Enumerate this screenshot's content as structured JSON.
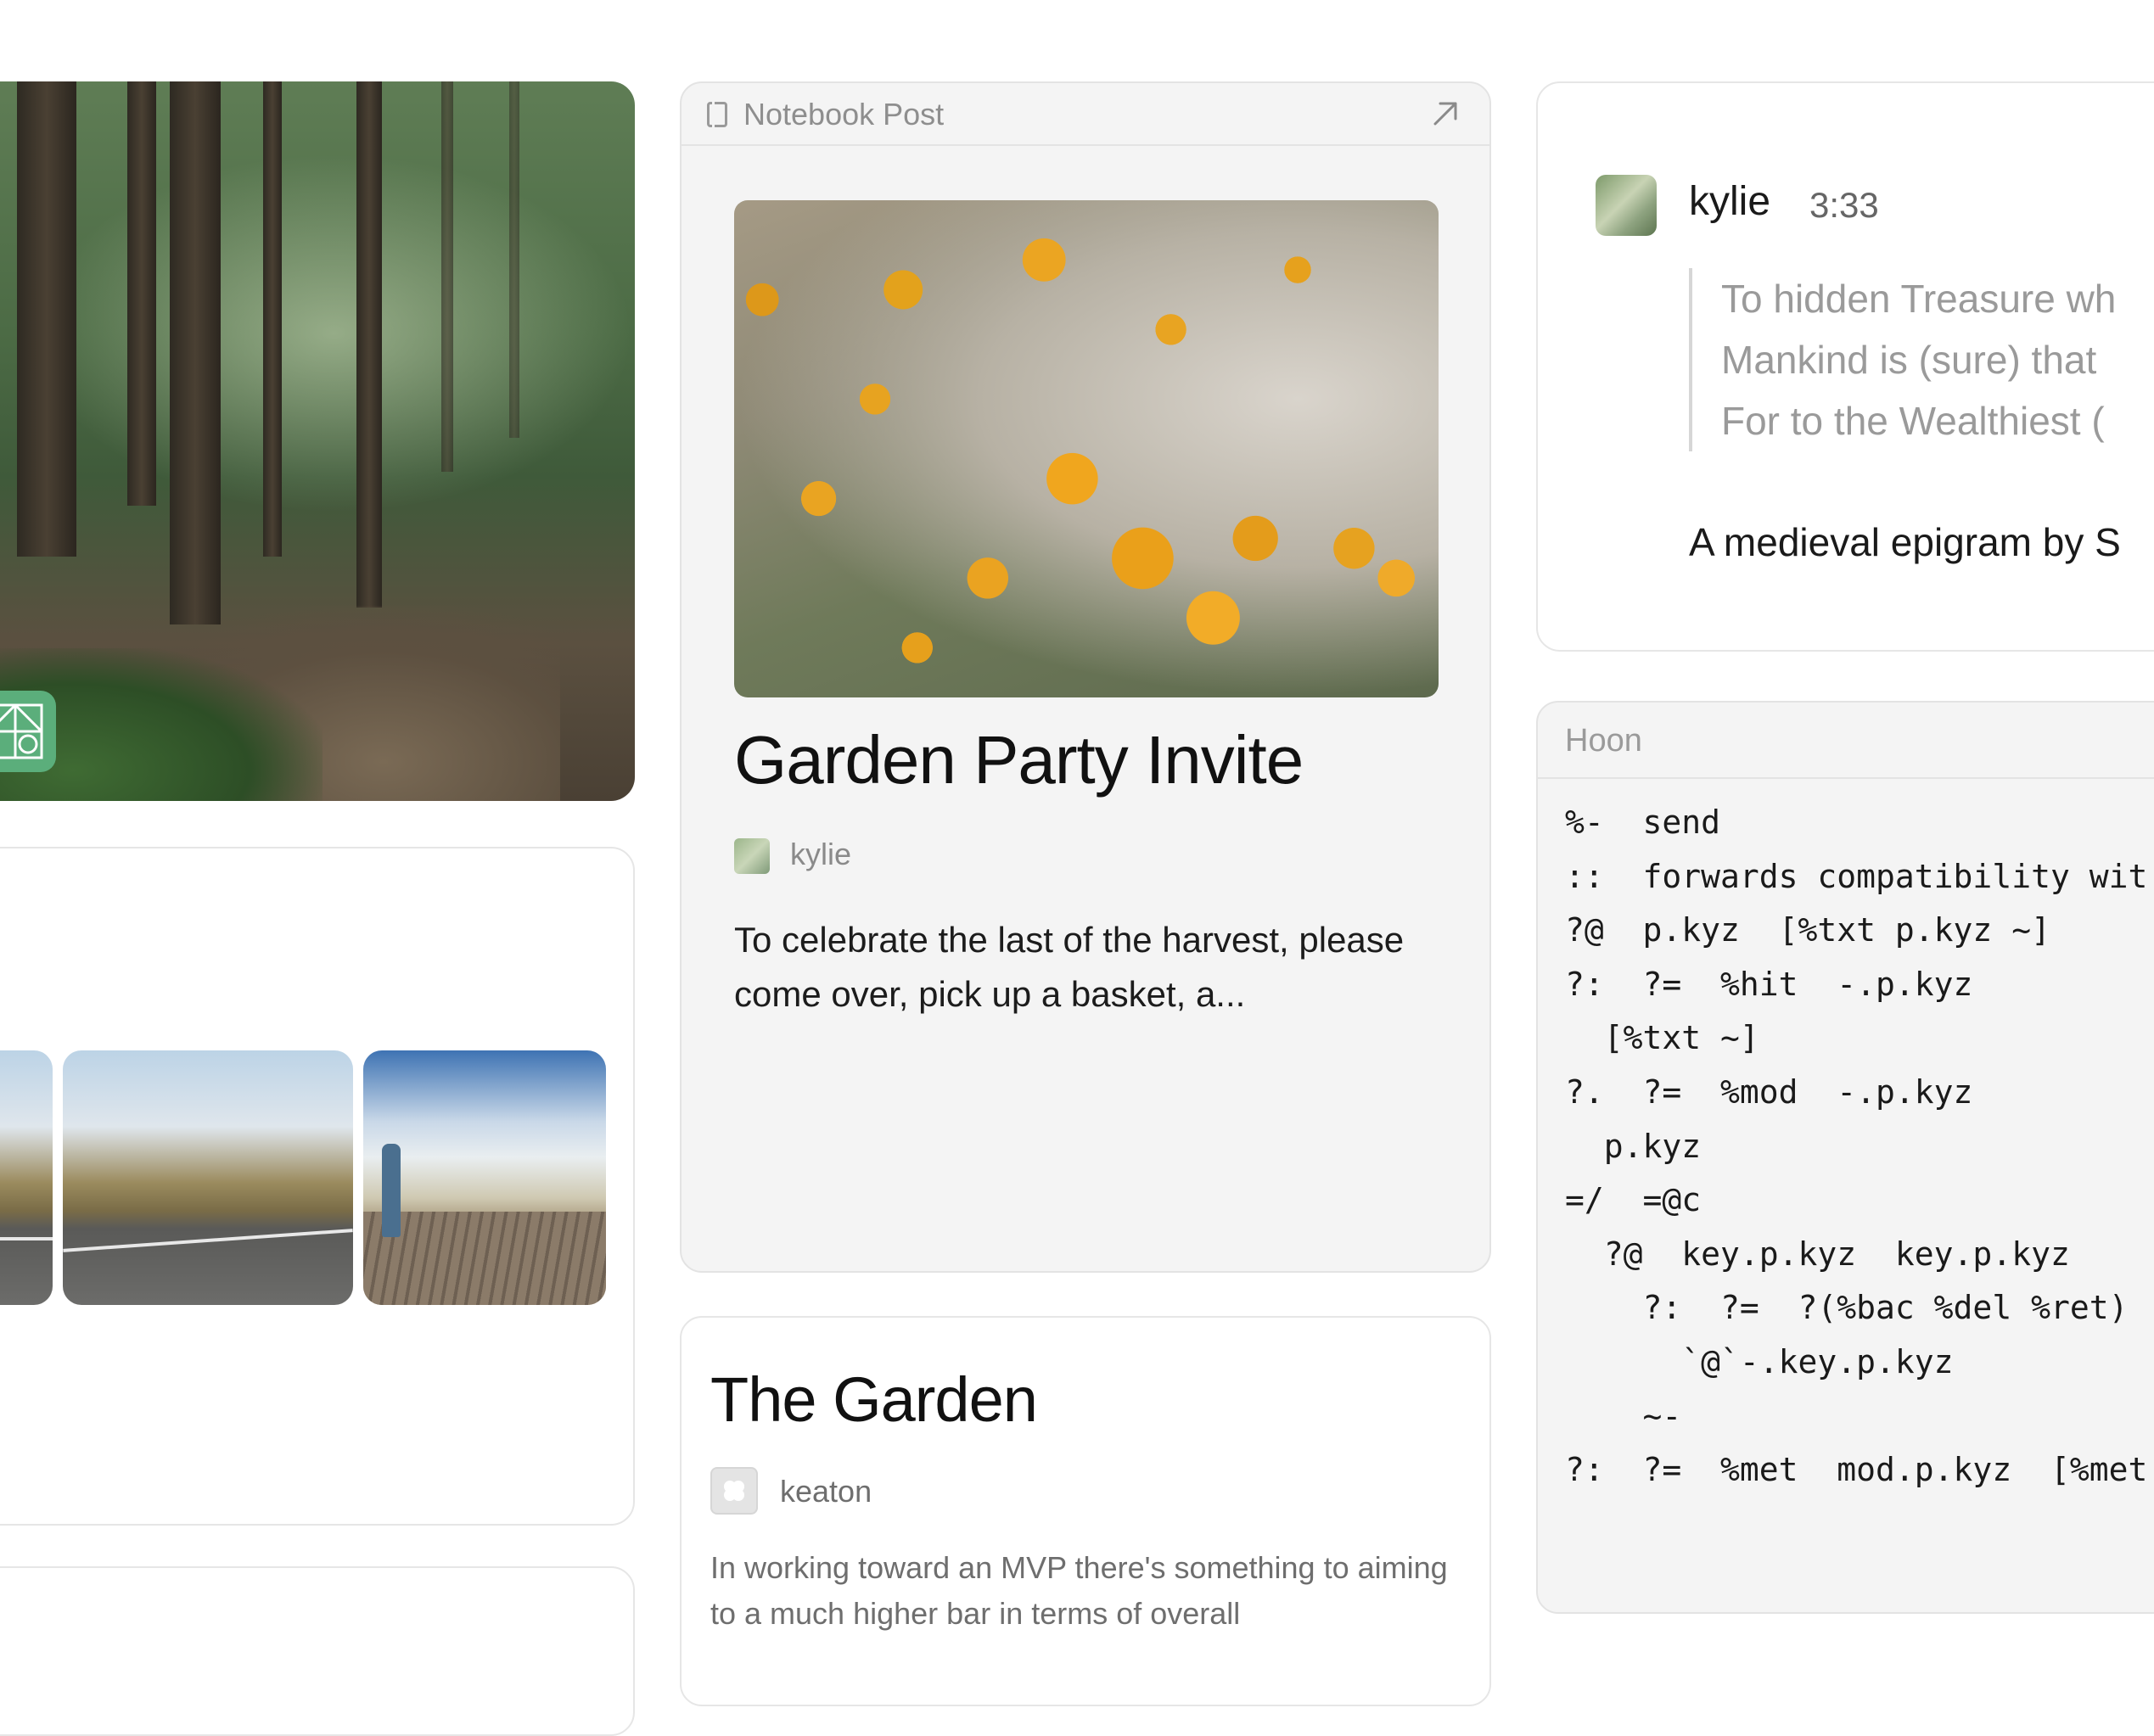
{
  "notebook_post": {
    "header_label": "Notebook Post",
    "title": "Garden Party Invite",
    "author": "kylie",
    "excerpt": "To celebrate the last of the harvest, please come over, pick up a basket, a..."
  },
  "garden_post": {
    "title": "The Garden",
    "author": "keaton",
    "excerpt": "In working toward an MVP there's something to aiming to a much higher bar in terms of overall"
  },
  "chat_message": {
    "author": "kylie",
    "time": "3:33",
    "quote_lines": [
      "To hidden Treasure wh",
      "Mankind is (sure) that",
      "For to the Wealthiest ("
    ],
    "body": "A medieval epigram by S"
  },
  "code_block": {
    "label": "Hoon",
    "lines": [
      "%-  send",
      "::  forwards compatibility wit",
      "?@  p.kyz  [%txt p.kyz ~]",
      "?:  ?=  %hit  -.p.kyz",
      "  [%txt ~]",
      "?.  ?=  %mod  -.p.kyz",
      "  p.kyz",
      "=/  =@c",
      "  ?@  key.p.kyz  key.p.kyz",
      "    ?:  ?=  ?(%bac %del %ret)",
      "      `@`-.key.p.kyz",
      "    ~-",
      "?:  ?=  %met  mod.p.kyz  [%met"
    ]
  },
  "icons": {
    "app_badge": "app-grid-icon",
    "notebook": "notebook-icon",
    "open": "arrow-up-right-icon",
    "default_avatar": "flower-avatar-icon"
  },
  "colors": {
    "badge_green": "#5bae7b",
    "card_gray": "#f4f4f4",
    "muted_text": "#8e8e8e"
  }
}
